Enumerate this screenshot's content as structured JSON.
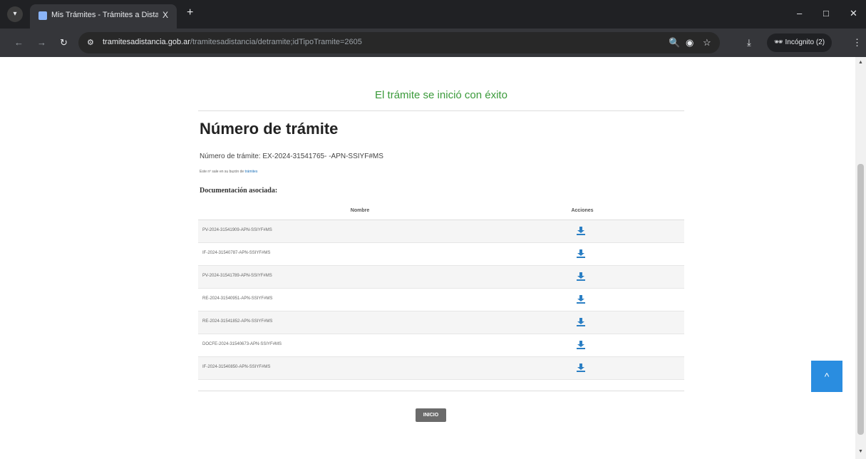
{
  "browser": {
    "tab_title": "Mis Trámites - Trámites a Distar",
    "tab_close": "X",
    "new_tab": "+",
    "url_host": "tramitesadistancia.gob.ar",
    "url_path": "/tramitesadistancia/detramite;idTipoTramite=2605",
    "incognito_label": "Incógnito (2)",
    "window_controls": {
      "minimize": "–",
      "maximize": "□",
      "close": "✕"
    }
  },
  "page": {
    "success_message": "El trámite se inició con éxito",
    "heading": "Número de trámite",
    "tramite_number_line": "Número de trámite: EX-2024-31541765- -APN-SSIYF#MS",
    "note_text": "Este nº sale en su buzón de",
    "note_link": "trámites",
    "documentation_title": "Documentación asociada:",
    "table": {
      "columns": [
        "Nombre",
        "Acciones"
      ],
      "rows": [
        "PV-2024-31541909-APN-SSIYF#MS",
        "IF-2024-31540787-APN-SSIYF#MS",
        "PV-2024-31541789-APN-SSIYF#MS",
        "RE-2024-31540951-APN-SSIYF#MS",
        "RE-2024-31541852-APN-SSIYF#MS",
        "DOCFE-2024-31540673-APN-SSIYF#MS",
        "IF-2024-31540850-APN-SSIYF#MS"
      ]
    },
    "inicio_button": "INICIO",
    "back_to_top": "^"
  },
  "colors": {
    "success_green": "#3a9a3a",
    "download_blue": "#2b7fc4",
    "to_top_blue": "#2a8de0"
  }
}
